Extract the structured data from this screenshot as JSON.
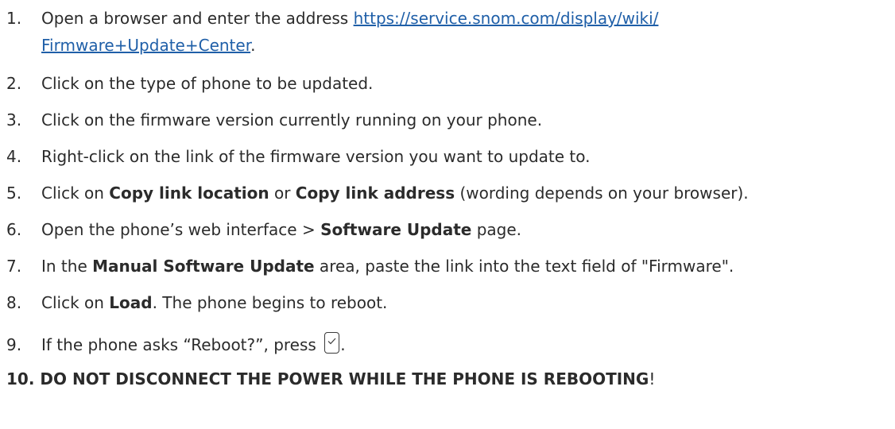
{
  "steps": [
    {
      "num": "1.",
      "pre": "Open a browser and enter the address ",
      "link_line1": "https://service.snom.com/display/wiki/",
      "link_line2": "Firmware+Update+Center",
      "post": "."
    },
    {
      "num": "2.",
      "text": "Click on the type of phone to be updated."
    },
    {
      "num": "3.",
      "text": "Click on the firmware version currently running on your phone."
    },
    {
      "num": "4.",
      "text": "Right-click on the link of the firmware version you want to update to."
    },
    {
      "num": "5.",
      "pre": "Click on ",
      "bold1": "Copy link location",
      "mid": " or ",
      "bold2": "Copy link address",
      "post": " (wording depends on your browser)."
    },
    {
      "num": "6.",
      "pre": "Open the phone’s web interface > ",
      "bold1": "Software Update",
      "post": " page."
    },
    {
      "num": "7.",
      "pre": "In the ",
      "bold1": "Manual Software Update",
      "post": " area, paste the link into the text field of \"Firmware\"."
    },
    {
      "num": "8.",
      "pre": "Click on ",
      "bold1": "Load",
      "post": ".  The phone begins to reboot."
    },
    {
      "num": "9.",
      "pre": "If the phone asks “Reboot?”, press ",
      "icon": "checkmark-key-icon",
      "post": "."
    }
  ],
  "warning": {
    "text": "10. DO NOT DISCONNECT THE POWER WHILE THE PHONE IS REBOOTING",
    "bang": "!"
  }
}
